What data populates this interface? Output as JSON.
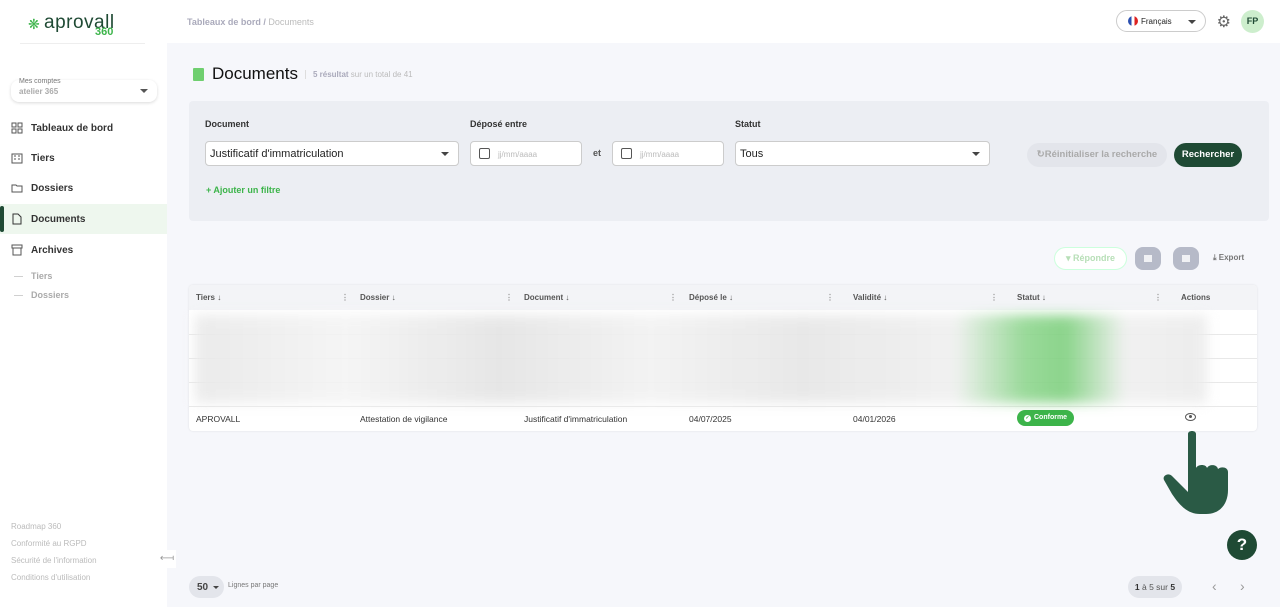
{
  "brand": {
    "name": "aprovall",
    "suffix": "360"
  },
  "account": {
    "label": "Mes comptes",
    "value": "atelier 365"
  },
  "nav": [
    {
      "label": "Tableaux de bord",
      "icon": "dashboard-icon"
    },
    {
      "label": "Tiers",
      "icon": "building-icon"
    },
    {
      "label": "Dossiers",
      "icon": "folder-icon"
    },
    {
      "label": "Documents",
      "icon": "document-icon",
      "active": true
    },
    {
      "label": "Archives",
      "icon": "archive-icon"
    }
  ],
  "archive_sub": [
    "Tiers",
    "Dossiers"
  ],
  "footer_links": [
    "Roadmap 360",
    "Conformité au RGPD",
    "Sécurité de l'information",
    "Conditions d'utilisation"
  ],
  "breadcrumb": {
    "parent": "Tableaux de bord",
    "sep": " / ",
    "current": "Documents"
  },
  "header": {
    "language": "Français",
    "avatar": "FP"
  },
  "page": {
    "title": "Documents",
    "count_bold": "5 résultat",
    "count_rest": " sur un total de 41"
  },
  "filters": {
    "document_label": "Document",
    "document_value": "Justificatif d'immatriculation",
    "date_label": "Déposé entre",
    "date_placeholder": "jj/mm/aaaa",
    "and": "et",
    "status_label": "Statut",
    "status_value": "Tous",
    "add_filter": "+ Ajouter un filtre",
    "reset": "Réinitialiser la recherche",
    "search": "Rechercher"
  },
  "toolbar": {
    "respond": "Répondre",
    "export": "Export"
  },
  "table": {
    "columns": [
      "Tiers",
      "Dossier",
      "Document",
      "Déposé le",
      "Validité",
      "Statut",
      "Actions"
    ],
    "rows": [
      {
        "tiers": "APROVALL",
        "dossier": "Attestation de vigilance",
        "document": "Justificatif d'immatriculation",
        "depose": "04/07/2025",
        "validite": "04/01/2026",
        "statut": "Conforme"
      }
    ]
  },
  "pagination": {
    "per_page": "50",
    "per_page_label": "Lignes par page",
    "range_bold1": "1",
    "range_mid": " à 5 sur ",
    "range_bold2": "5"
  },
  "help": "?",
  "colors": {
    "primary": "#1f4a34",
    "accent": "#3cb44a"
  }
}
